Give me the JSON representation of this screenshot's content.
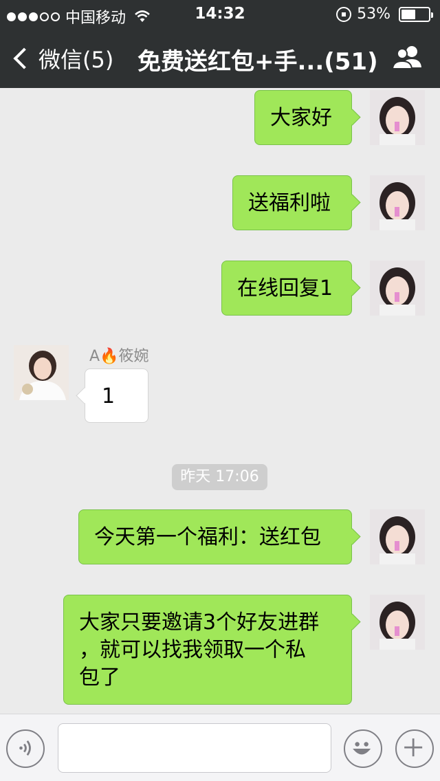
{
  "status_bar": {
    "carrier": "中国移动",
    "time": "14:32",
    "battery": "53%",
    "battery_level": 0.53,
    "signal_strength": 3
  },
  "nav": {
    "back_label": "微信(5)",
    "title": "免费送红包+手...(51)"
  },
  "messages": [
    {
      "text": "大家好"
    },
    {
      "text": "送福利啦"
    },
    {
      "text": "在线回复1"
    },
    {
      "sender": "A🔥筱婉",
      "text": "1"
    },
    {
      "text": "今天第一个福利：送红包"
    },
    {
      "line1": "大家只要邀请3个好友进群",
      "line2": "，就可以找我领取一个私",
      "line3": "包了"
    }
  ],
  "timestamp": "昨天 17:06",
  "input": {
    "placeholder": ""
  },
  "icons": [
    "wifi-icon",
    "rotation-lock-icon",
    "battery-icon",
    "back-chevron-icon",
    "group-members-icon",
    "voice-icon",
    "emoji-icon",
    "plus-icon"
  ],
  "colors": {
    "header_bg": "#2e3132",
    "chat_bg": "#ebebeb",
    "my_bubble": "#a0e759",
    "their_bubble": "#ffffff"
  }
}
